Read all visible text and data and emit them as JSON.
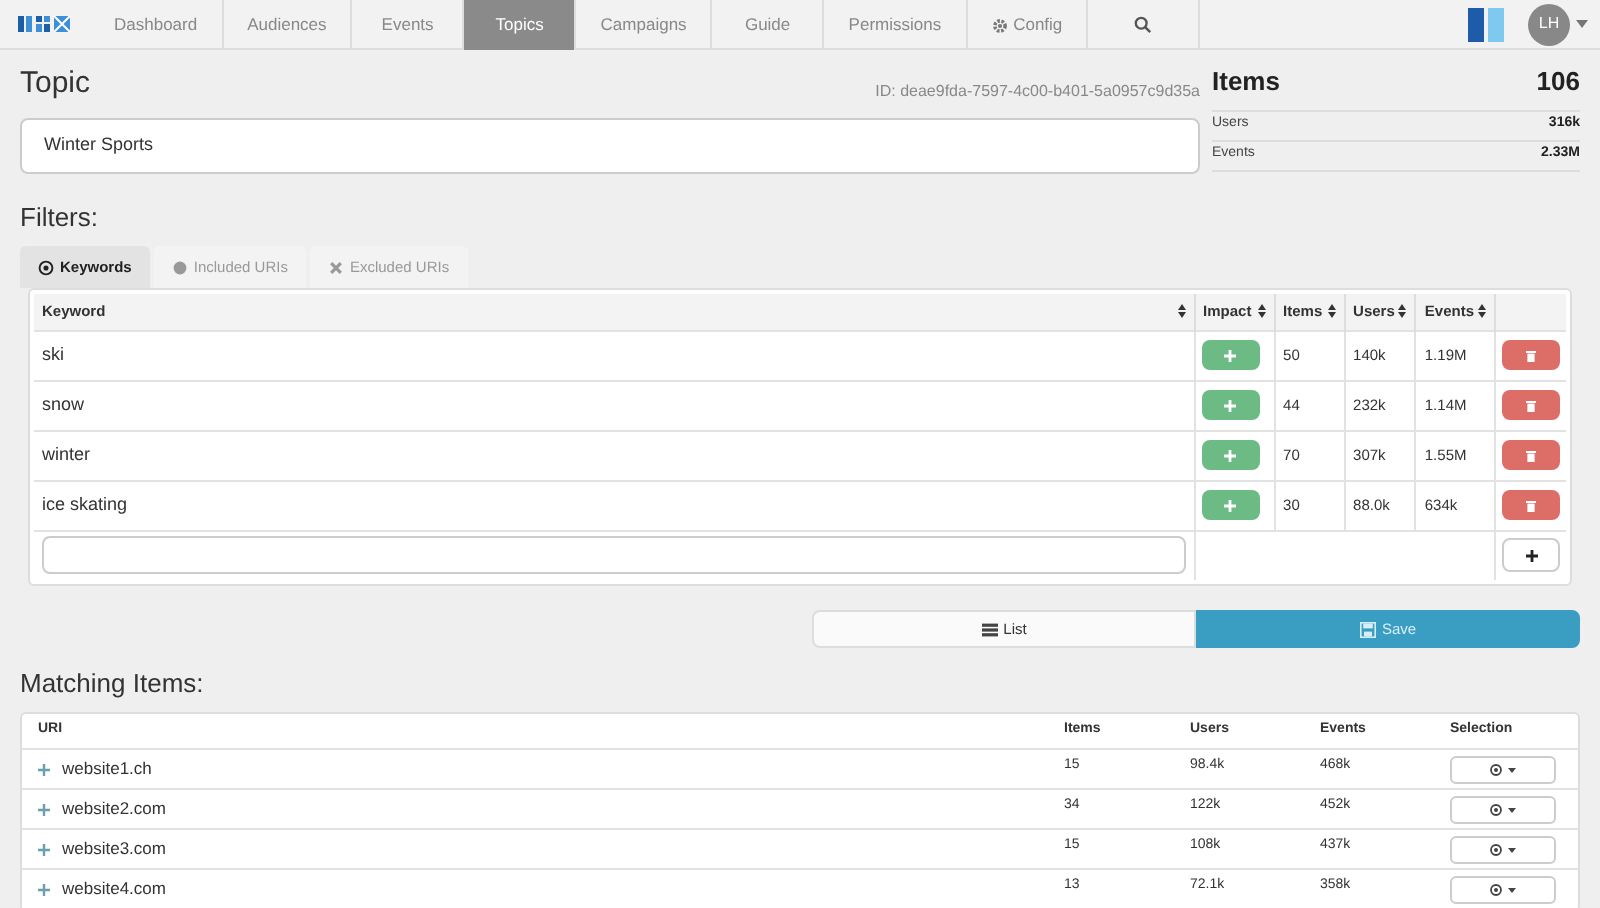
{
  "nav": {
    "items": [
      {
        "label": "Dashboard",
        "selected": false
      },
      {
        "label": "Audiences",
        "selected": false
      },
      {
        "label": "Events",
        "selected": false
      },
      {
        "label": "Topics",
        "selected": true
      },
      {
        "label": "Campaigns",
        "selected": false
      },
      {
        "label": "Guide",
        "selected": false
      },
      {
        "label": "Permissions",
        "selected": false
      },
      {
        "label": "Config",
        "selected": false
      }
    ],
    "avatar": "LH"
  },
  "topic": {
    "heading": "Topic",
    "id": "ID: deae9fda-7597-4c00-b401-5a0957c9d35a",
    "name": "Winter Sports"
  },
  "summary": {
    "title": "Items",
    "total": "106",
    "rows": [
      {
        "label": "Users",
        "value": "316k"
      },
      {
        "label": "Events",
        "value": "2.33M"
      }
    ]
  },
  "filters": {
    "heading": "Filters:",
    "tabs": [
      {
        "label": "Keywords",
        "selected": true
      },
      {
        "label": "Included URIs",
        "selected": false
      },
      {
        "label": "Excluded URIs",
        "selected": false
      }
    ],
    "columns": [
      "Keyword",
      "Impact",
      "Items",
      "Users",
      "Events"
    ],
    "rows": [
      {
        "keyword": "ski",
        "items": "50",
        "users": "140k",
        "events": "1.19M"
      },
      {
        "keyword": "snow",
        "items": "44",
        "users": "232k",
        "events": "1.14M"
      },
      {
        "keyword": "winter",
        "items": "70",
        "users": "307k",
        "events": "1.55M"
      },
      {
        "keyword": "ice skating",
        "items": "30",
        "users": "88.0k",
        "events": "634k"
      }
    ]
  },
  "view_buttons": [
    {
      "label": "List",
      "selected": false
    },
    {
      "label": "Save",
      "selected": true
    }
  ],
  "matching": {
    "heading": "Matching Items:",
    "columns": [
      "URI",
      "Items",
      "Users",
      "Events",
      "Selection"
    ],
    "rows": [
      {
        "uri": "website1.ch",
        "items": "15",
        "users": "98.4k",
        "events": "468k"
      },
      {
        "uri": "website2.com",
        "items": "34",
        "users": "122k",
        "events": "452k"
      },
      {
        "uri": "website3.com",
        "items": "15",
        "users": "108k",
        "events": "437k"
      },
      {
        "uri": "website4.com",
        "items": "13",
        "users": "72.1k",
        "events": "358k"
      }
    ]
  }
}
